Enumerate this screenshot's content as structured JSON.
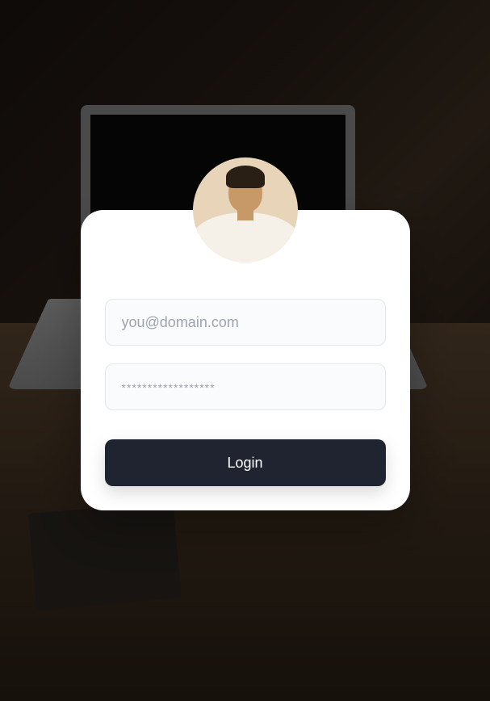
{
  "login": {
    "email_placeholder": "you@domain.com",
    "email_value": "",
    "password_placeholder": "******************",
    "password_value": "",
    "submit_label": "Login"
  }
}
